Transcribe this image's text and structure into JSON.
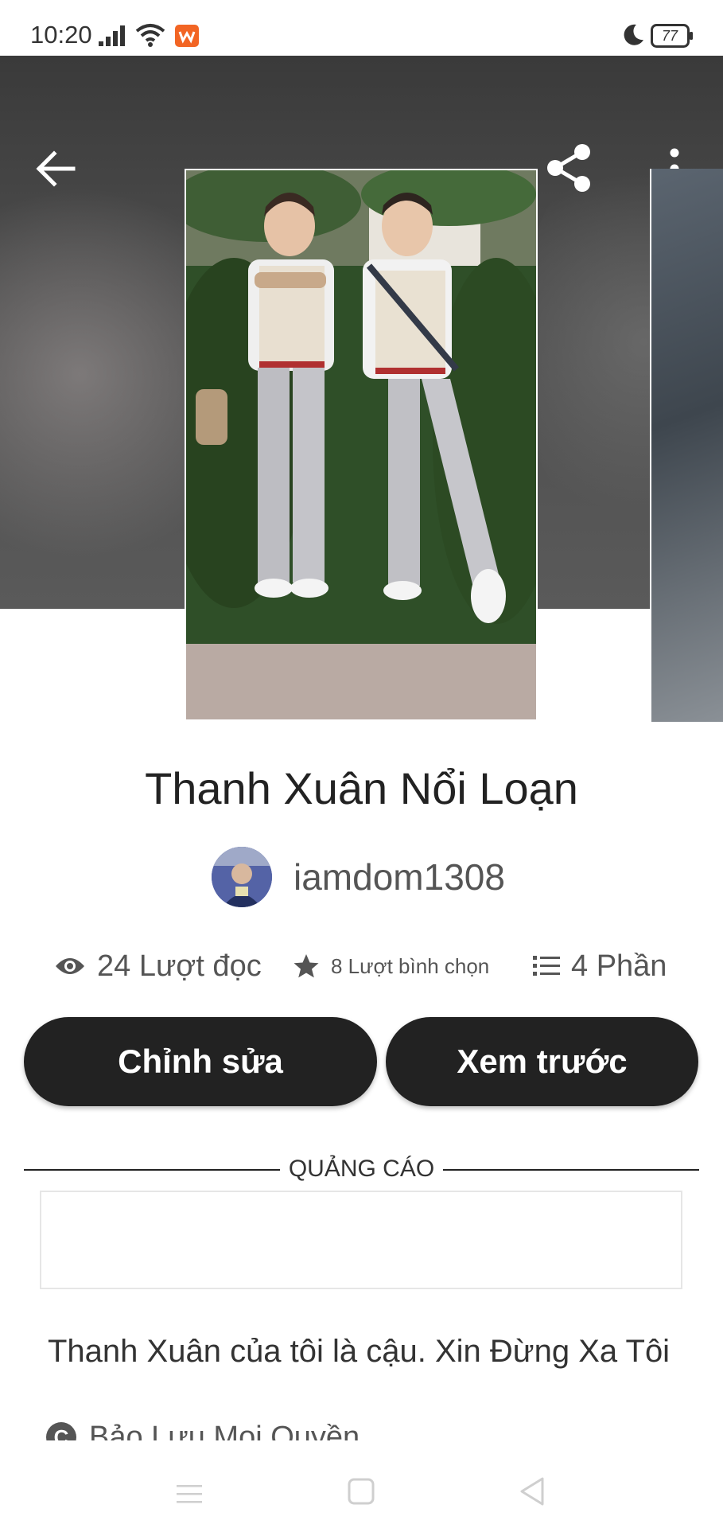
{
  "status_bar": {
    "time": "10:20",
    "battery": "77",
    "icons": [
      "signal-icon",
      "wifi-icon",
      "app-badge-icon",
      "moon-icon",
      "battery-icon"
    ]
  },
  "toolbar": {
    "back_icon": "arrow-left-icon",
    "share_icon": "share-icon",
    "more_icon": "more-vertical-icon"
  },
  "story": {
    "title": "Thanh Xuân Nổi Loạn",
    "author": "iamdom1308",
    "stats": {
      "reads": "24 Lượt đọc",
      "votes": "8 Lượt bình chọn",
      "parts": "4 Phần"
    },
    "description": "Thanh Xuân của tôi là cậu. Xin Đừng Xa Tôi",
    "copyright": "Bảo Lưu Mọi Quyền"
  },
  "actions": {
    "edit_label": "Chỉnh sửa",
    "preview_label": "Xem trước"
  },
  "ad": {
    "label": "QUẢNG CÁO"
  },
  "nav_bar": {
    "icons": [
      "menu-icon",
      "home-square-icon",
      "back-triangle-icon"
    ]
  },
  "colors": {
    "button_bg": "#222222",
    "accent": "#f26524",
    "text_primary": "#222222",
    "text_secondary": "#555555"
  }
}
